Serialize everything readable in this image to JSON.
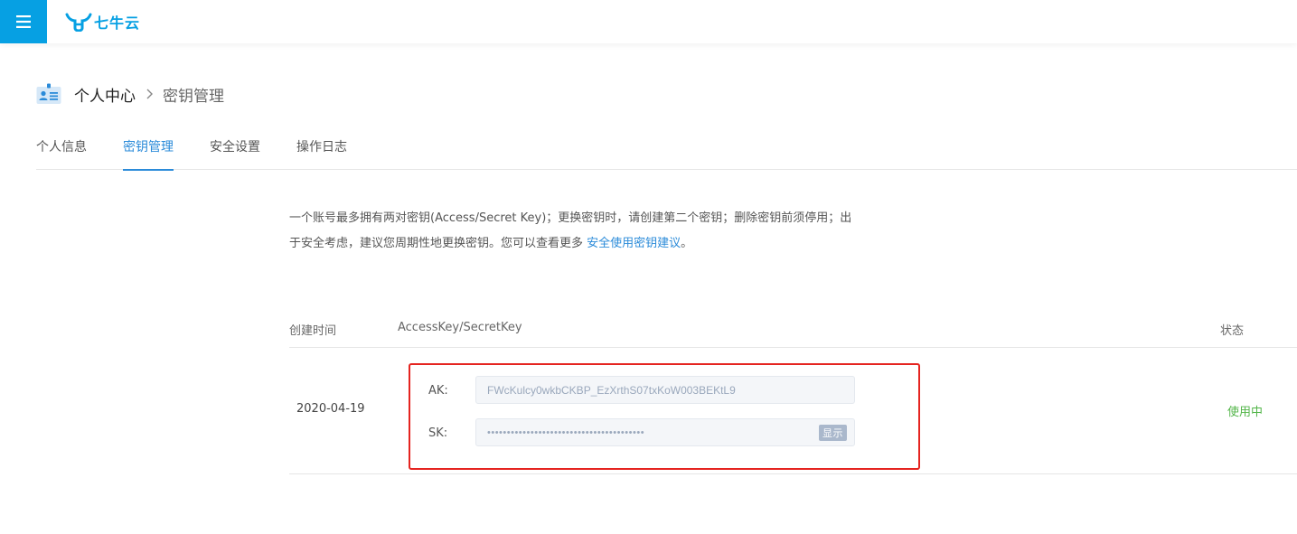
{
  "header": {
    "brand_name": "七牛云",
    "menu_icon": "hamburger-icon",
    "logo_icon": "qiniu-logo-icon",
    "brand_color": "#06a0e3"
  },
  "breadcrumb": {
    "icon": "id-card-icon",
    "section": "个人中心",
    "page": "密钥管理"
  },
  "tabs": [
    {
      "label": "个人信息",
      "active": false
    },
    {
      "label": "密钥管理",
      "active": true
    },
    {
      "label": "安全设置",
      "active": false
    },
    {
      "label": "操作日志",
      "active": false
    }
  ],
  "notice": {
    "text": "一个账号最多拥有两对密钥(Access/Secret Key)；更换密钥时，请创建第二个密钥；删除密钥前须停用；出于安全考虑，建议您周期性地更换密钥。您可以查看更多 ",
    "link": "安全使用密钥建议",
    "suffix": "。"
  },
  "table": {
    "headers": {
      "created": "创建时间",
      "keys": "AccessKey/SecretKey",
      "status": "状态"
    },
    "rows": [
      {
        "created": "2020-04-19",
        "ak_label": "AK:",
        "ak_value": "FWcKulcy0wkbCKBP_EzXrthS07txKoW003BEKtL9",
        "sk_label": "SK:",
        "sk_value": "••••••••••••••••••••••••••••••••••••••••",
        "show_label": "显示",
        "status": "使用中"
      }
    ]
  },
  "colors": {
    "accent": "#2b8bd9",
    "status_active": "#52b548",
    "highlight_border": "#e52420"
  }
}
